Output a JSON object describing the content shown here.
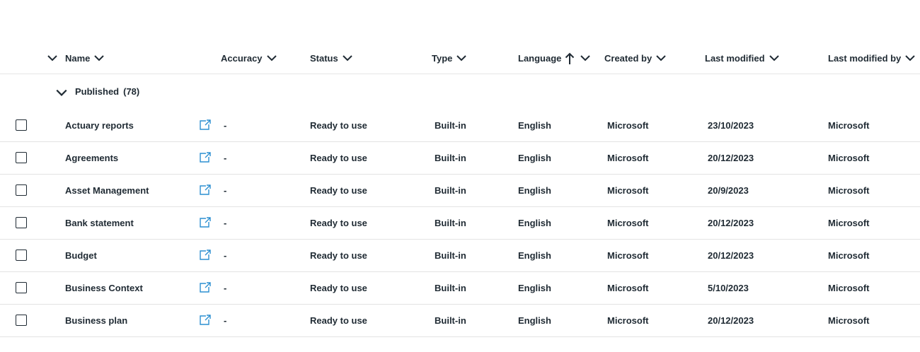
{
  "columns": {
    "name": "Name",
    "accuracy": "Accuracy",
    "status": "Status",
    "type": "Type",
    "language": "Language",
    "created_by": "Created by",
    "last_modified": "Last modified",
    "last_modified_by": "Last modified by"
  },
  "sort": {
    "column": "language",
    "direction": "ascending",
    "icon": "arrow-up-icon"
  },
  "group": {
    "label": "Published",
    "count": "(78)"
  },
  "rows": [
    {
      "name": "Actuary reports",
      "accuracy": "-",
      "status": "Ready to use",
      "type": "Built-in",
      "language": "English",
      "created_by": "Microsoft",
      "last_modified": "23/10/2023",
      "last_modified_by": "Microsoft"
    },
    {
      "name": "Agreements",
      "accuracy": "-",
      "status": "Ready to use",
      "type": "Built-in",
      "language": "English",
      "created_by": "Microsoft",
      "last_modified": "20/12/2023",
      "last_modified_by": "Microsoft"
    },
    {
      "name": "Asset Management",
      "accuracy": "-",
      "status": "Ready to use",
      "type": "Built-in",
      "language": "English",
      "created_by": "Microsoft",
      "last_modified": "20/9/2023",
      "last_modified_by": "Microsoft"
    },
    {
      "name": "Bank statement",
      "accuracy": "-",
      "status": "Ready to use",
      "type": "Built-in",
      "language": "English",
      "created_by": "Microsoft",
      "last_modified": "20/12/2023",
      "last_modified_by": "Microsoft"
    },
    {
      "name": "Budget",
      "accuracy": "-",
      "status": "Ready to use",
      "type": "Built-in",
      "language": "English",
      "created_by": "Microsoft",
      "last_modified": "20/12/2023",
      "last_modified_by": "Microsoft"
    },
    {
      "name": "Business Context",
      "accuracy": "-",
      "status": "Ready to use",
      "type": "Built-in",
      "language": "English",
      "created_by": "Microsoft",
      "last_modified": "5/10/2023",
      "last_modified_by": "Microsoft"
    },
    {
      "name": "Business plan",
      "accuracy": "-",
      "status": "Ready to use",
      "type": "Built-in",
      "language": "English",
      "created_by": "Microsoft",
      "last_modified": "20/12/2023",
      "last_modified_by": "Microsoft"
    }
  ],
  "colors": {
    "text": "#1f2a33",
    "link_icon": "#2b8fd1",
    "divider": "#e3e3e3"
  }
}
